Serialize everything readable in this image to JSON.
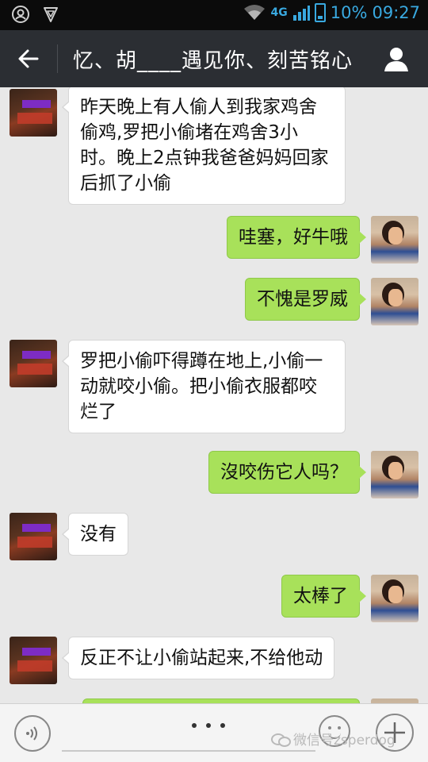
{
  "status_bar": {
    "network": "4G",
    "battery": "10%",
    "time": "09:27"
  },
  "header": {
    "title": "忆、胡____遇见你、刻苦铭心"
  },
  "messages": [
    {
      "from": "other",
      "text": "昨天晚上有人偷人到我家鸡舍偷鸡,罗把小偷堵在鸡舍3小时。晚上2点钟我爸爸妈妈回家后抓了小偷"
    },
    {
      "from": "me",
      "text": "哇塞，好牛哦"
    },
    {
      "from": "me",
      "text": "不愧是罗威"
    },
    {
      "from": "other",
      "text": "罗把小偷吓得蹲在地上,小偷一动就咬小偷。把小偷衣服都咬烂了"
    },
    {
      "from": "me",
      "text": "沒咬伤它人吗？"
    },
    {
      "from": "other",
      "text": "没有"
    },
    {
      "from": "me",
      "text": "太棒了"
    },
    {
      "from": "other",
      "text": "反正不让小偷站起来,不给他动"
    }
  ],
  "watermark": "微信号zsperdog",
  "colors": {
    "status_bar_bg": "#0b0b0b",
    "status_accent": "#39a9e0",
    "header_bg": "#2b2e33",
    "chat_bg": "#e8e8e8",
    "my_bubble": "#a8e15a",
    "their_bubble": "#ffffff"
  }
}
